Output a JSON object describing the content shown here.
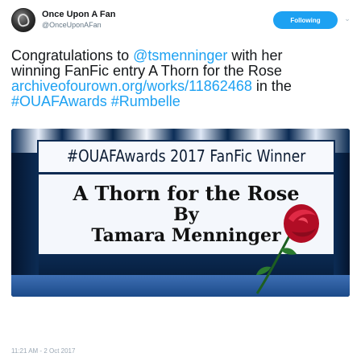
{
  "tweet": {
    "author": {
      "display_name": "Once Upon A Fan",
      "handle": "@OnceUponAFan"
    },
    "follow_button_label": "Following",
    "text": {
      "line1_a": "Congratulations to ",
      "line1_mention": "@tsmenninger",
      "line1_b": " with her",
      "line2": "winning FanFic entry A Thorn for the Rose",
      "line3_link": "archiveofourown.org/works/11862468",
      "line3_b": " in the",
      "line4_tags": "#OUAFAwards #Rumbelle"
    },
    "timestamp": "11:21 AM - 2 Oct 2017"
  },
  "image": {
    "title": "#OUAFAwards 2017 FanFic Winner",
    "line1": "A Thorn for the Rose",
    "line2": "By",
    "line3": "Tamara Menninger"
  },
  "colors": {
    "link": "#1da1f2",
    "follow_button": "#1da1f2",
    "panel_border": "#0b2a52",
    "rose": "#c8102e"
  },
  "icons": {
    "avatar": "avatar-logo",
    "caret": "chevron-down-icon"
  }
}
